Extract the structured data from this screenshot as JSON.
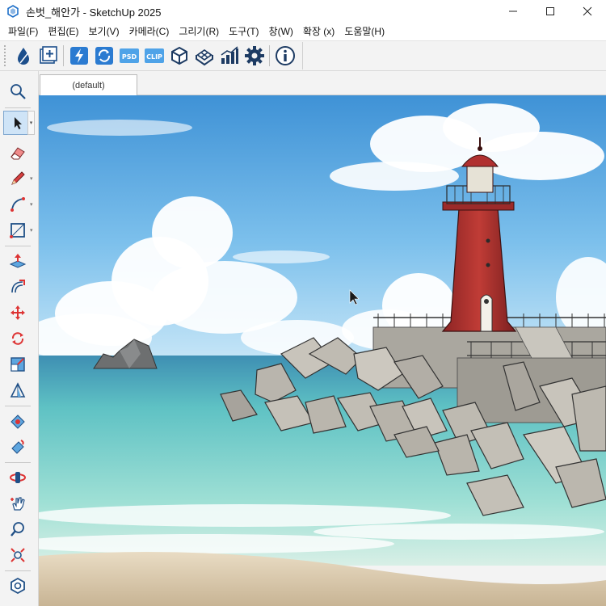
{
  "window": {
    "title": "손벗_해안가 - SketchUp 2025",
    "controls": [
      "minimize",
      "maximize",
      "close"
    ]
  },
  "menu": [
    {
      "label": "파일(F)"
    },
    {
      "label": "편집(E)"
    },
    {
      "label": "보기(V)"
    },
    {
      "label": "카메라(C)"
    },
    {
      "label": "그리기(R)"
    },
    {
      "label": "도구(T)"
    },
    {
      "label": "창(W)"
    },
    {
      "label": "확장 (x)"
    },
    {
      "label": "도움말(H)"
    }
  ],
  "toolbar": {
    "icons": [
      "ink-drop-icon",
      "add-layer-icon",
      "lightning-icon",
      "refresh-icon",
      "psd-icon",
      "clip-icon",
      "cube-icon",
      "grid-tile-icon",
      "bar-chart-icon",
      "gear-icon",
      "info-icon"
    ],
    "psd_text": "PSD",
    "clip_text": "CLIP"
  },
  "left_tools": [
    "search-icon",
    "select-arrow-icon",
    "eraser-icon",
    "pencil-icon",
    "arc-icon",
    "rectangle-icon",
    "push-pull-icon",
    "offset-icon",
    "move-icon",
    "rotate-icon",
    "scale-icon",
    "tape-measure-icon",
    "paint-bucket-icon",
    "paint-icon",
    "orbit-icon",
    "pan-icon",
    "zoom-icon",
    "zoom-extents-icon",
    "component-icon"
  ],
  "scenes": {
    "active_tab": "(default)"
  },
  "colors": {
    "accent": "#1d6fc9",
    "lighthouse_red": "#b0322e",
    "sky": "#4aa3df",
    "sea": "#67c8c2"
  }
}
